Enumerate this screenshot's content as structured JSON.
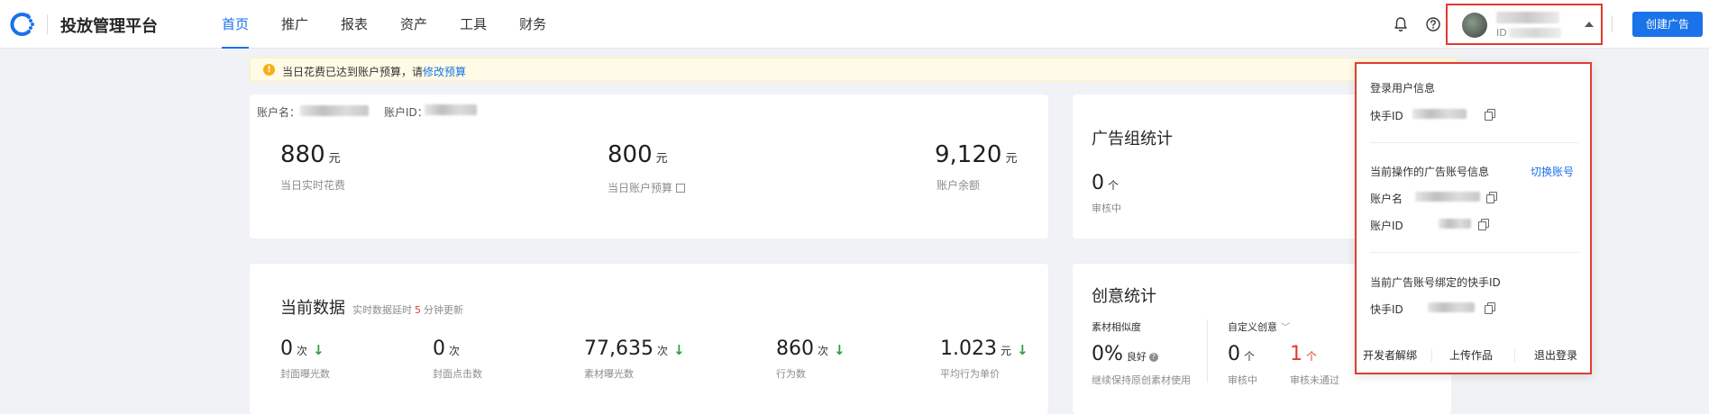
{
  "app": {
    "brand": "投放管理平台",
    "accent_color": "#1a73e8",
    "logo_icon": "kuaishou-logo-icon"
  },
  "nav": {
    "items": [
      {
        "label": "首页",
        "active": true
      },
      {
        "label": "推广"
      },
      {
        "label": "报表"
      },
      {
        "label": "资产"
      },
      {
        "label": "工具"
      },
      {
        "label": "财务"
      }
    ]
  },
  "header": {
    "notification_icon": "bell-icon",
    "help_icon": "help-circle-icon",
    "user": {
      "id_label": "ID"
    },
    "create_button": "创建广告"
  },
  "notice": {
    "text": "当日花费已达到账户预算，请",
    "link": "修改预算"
  },
  "account_overview": {
    "name_label": "账户名：",
    "id_label": "账户ID：",
    "metrics": [
      {
        "value": "880",
        "unit": "元",
        "label": "当日实时花费"
      },
      {
        "value": "800",
        "unit": "元",
        "label": "当日账户预算"
      },
      {
        "value": "9,120",
        "unit": "元",
        "label": "账户余额"
      }
    ]
  },
  "ad_group_stats": {
    "title": "广告组统计",
    "value": "0",
    "unit": "个",
    "label": "审核中"
  },
  "current_data": {
    "title": "当前数据",
    "hint_prefix": "实时数据延时",
    "hint_minutes": "5",
    "hint_suffix": "分钟更新",
    "metrics": [
      {
        "value": "0",
        "unit": "次",
        "label": "封面曝光数",
        "trend": "down"
      },
      {
        "value": "0",
        "unit": "次",
        "label": "封面点击数",
        "trend": "none"
      },
      {
        "value": "77,635",
        "unit": "次",
        "label": "素材曝光数",
        "trend": "down"
      },
      {
        "value": "860",
        "unit": "次",
        "label": "行为数",
        "trend": "down"
      },
      {
        "value": "1.023",
        "unit": "元",
        "label": "平均行为单价",
        "trend": "down"
      }
    ]
  },
  "creative_stats": {
    "title": "创意统计",
    "similarity": {
      "header": "素材相似度",
      "value": "0%",
      "rating": "良好",
      "note": "继续保持原创素材使用"
    },
    "custom": {
      "header": "自定义创意",
      "reviewing": {
        "value": "0",
        "unit": "个",
        "label": "审核中"
      },
      "rejected": {
        "value": "1",
        "unit": "个",
        "label": "审核未通过"
      }
    }
  },
  "user_dropdown": {
    "login_section_title": "登录用户信息",
    "kuaishou_id_label": "快手ID",
    "current_account_title": "当前操作的广告账号信息",
    "switch_account": "切换账号",
    "account_name_label": "账户名",
    "account_id_label": "账户ID",
    "bound_section_title": "当前广告账号绑定的快手ID",
    "bound_kuaishou_id_label": "快手ID",
    "footer": {
      "unbind": "开发者解绑",
      "upload": "上传作品",
      "logout": "退出登录"
    }
  }
}
